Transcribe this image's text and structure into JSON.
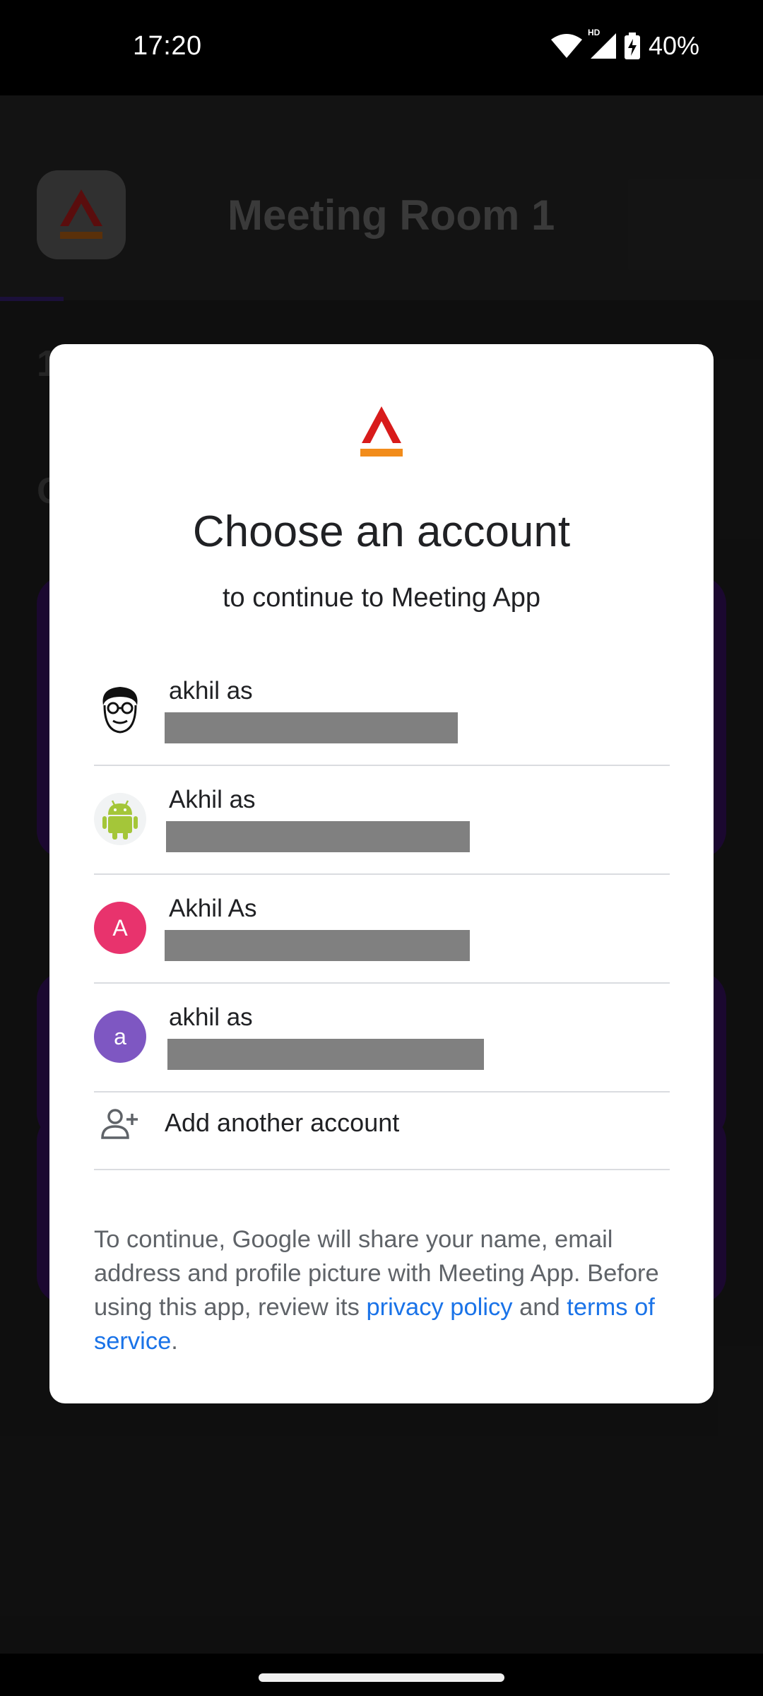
{
  "status_bar": {
    "time": "17:20",
    "network_badge": "HD",
    "battery_percent": "40%",
    "icons": [
      "wifi-icon",
      "cell-signal-icon",
      "battery-charging-icon"
    ]
  },
  "background_app": {
    "title": "Meeting Room 1",
    "hint_char_1": "1",
    "hint_char_2": "C"
  },
  "dialog": {
    "title": "Choose an account",
    "subtitle": "to continue to Meeting App",
    "accounts": [
      {
        "name": "akhil as",
        "avatar": "face-illustration",
        "avatar_letter": ""
      },
      {
        "name": "Akhil as",
        "avatar": "android-icon",
        "avatar_letter": ""
      },
      {
        "name": "Akhil As",
        "avatar": "letter",
        "avatar_letter": "A",
        "avatar_color": "#e8336d"
      },
      {
        "name": "akhil as",
        "avatar": "letter",
        "avatar_letter": "a",
        "avatar_color": "#7e57c2"
      }
    ],
    "add_account_label": "Add another account",
    "footer": {
      "text_before": "To continue, Google will share your name, email address and profile picture with Meeting App. Before using this app, review its ",
      "privacy_link": "privacy policy",
      "and_text": " and ",
      "terms_link": "terms of service",
      "end": "."
    }
  },
  "colors": {
    "link": "#1a73e8",
    "brand_red": "#d81b1b",
    "brand_orange": "#f28c1b"
  }
}
